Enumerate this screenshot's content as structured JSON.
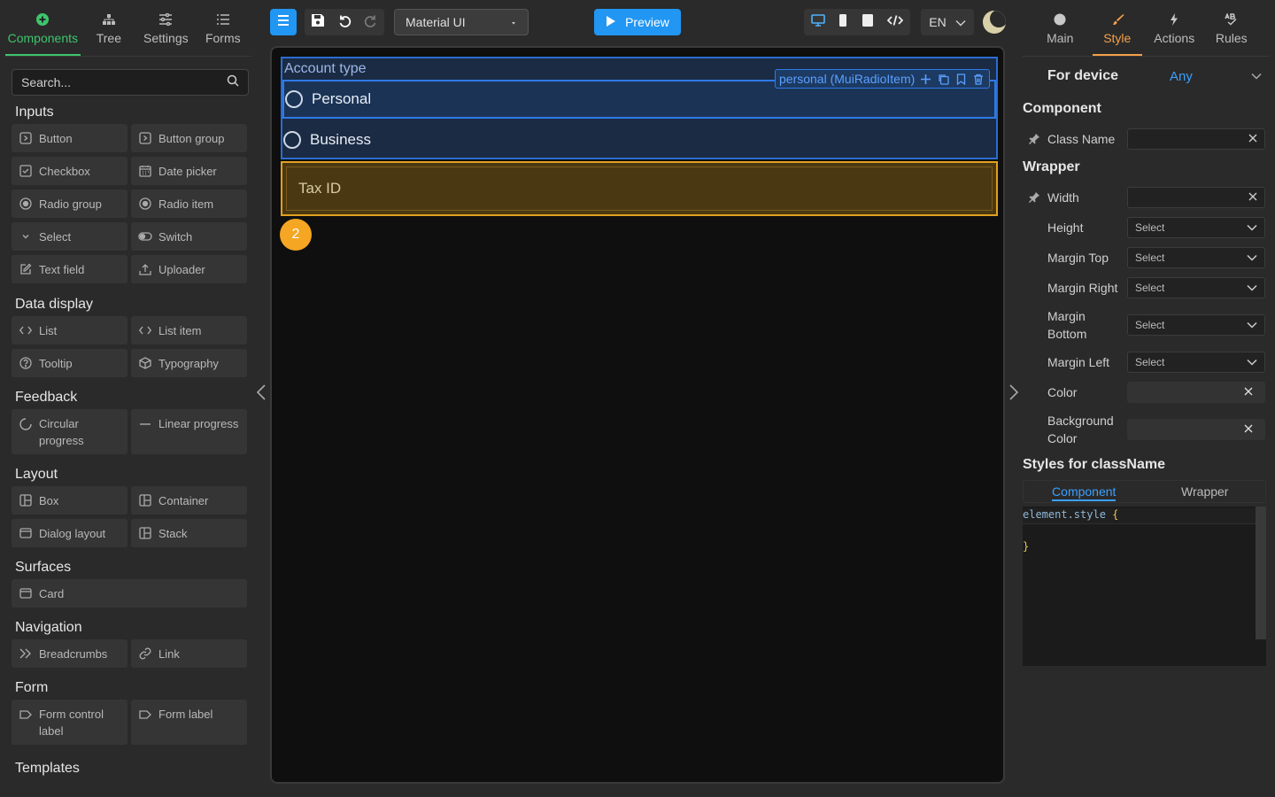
{
  "left": {
    "tabs": [
      {
        "label": "Components",
        "icon": "plus-circle-icon"
      },
      {
        "label": "Tree",
        "icon": "tree-icon"
      },
      {
        "label": "Settings",
        "icon": "sliders-icon"
      },
      {
        "label": "Forms",
        "icon": "list-icon"
      }
    ],
    "search_placeholder": "Search...",
    "sections": [
      {
        "title": "Inputs",
        "items": [
          "Button",
          "Button group",
          "Checkbox",
          "Date picker",
          "Radio group",
          "Radio item",
          "Select",
          "Switch",
          "Text field",
          "Uploader"
        ]
      },
      {
        "title": "Data display",
        "items": [
          "List",
          "List item",
          "Tooltip",
          "Typography"
        ]
      },
      {
        "title": "Feedback",
        "items": [
          "Circular progress",
          "Linear progress"
        ]
      },
      {
        "title": "Layout",
        "items": [
          "Box",
          "Container",
          "Dialog layout",
          "Stack"
        ]
      },
      {
        "title": "Surfaces",
        "items": [
          "Card"
        ]
      },
      {
        "title": "Navigation",
        "items": [
          "Breadcrumbs",
          "Link"
        ]
      },
      {
        "title": "Form",
        "items": [
          "Form control label",
          "Form label"
        ]
      },
      {
        "title": "Templates",
        "items": []
      }
    ]
  },
  "toolbar": {
    "theme_select": "Material UI",
    "preview_label": "Preview",
    "language": "EN"
  },
  "canvas": {
    "radio_group_label": "Account type",
    "radio_options": [
      "Personal",
      "Business"
    ],
    "selection_label": "personal (MuiRadioItem)",
    "text_field_label": "Tax ID",
    "badge_count": "2"
  },
  "right": {
    "tabs": [
      {
        "label": "Main",
        "icon": "circle-icon"
      },
      {
        "label": "Style",
        "icon": "brush-icon"
      },
      {
        "label": "Actions",
        "icon": "bolt-icon"
      },
      {
        "label": "Rules",
        "icon": "rules-icon"
      }
    ],
    "device_label": "For device",
    "device_value": "Any",
    "component_section": "Component",
    "class_name_label": "Class Name",
    "wrapper_section": "Wrapper",
    "width_label": "Width",
    "height_label": "Height",
    "margin_top_label": "Margin Top",
    "margin_right_label": "Margin Right",
    "margin_bottom_label": "Margin Bottom",
    "margin_left_label": "Margin Left",
    "color_label": "Color",
    "background_color_label": "Background Color",
    "select_placeholder": "Select",
    "styles_section": "Styles for className",
    "class_tabs": [
      "Component",
      "Wrapper"
    ],
    "code_selector": "element.style",
    "code_open": "{",
    "code_close": "}"
  },
  "colors": {
    "accent_green": "#3ec46d",
    "accent_blue": "#2196f3",
    "accent_orange": "#f5a04a",
    "selection_blue": "#2f7ae8",
    "highlight_amber": "#e0a020"
  }
}
